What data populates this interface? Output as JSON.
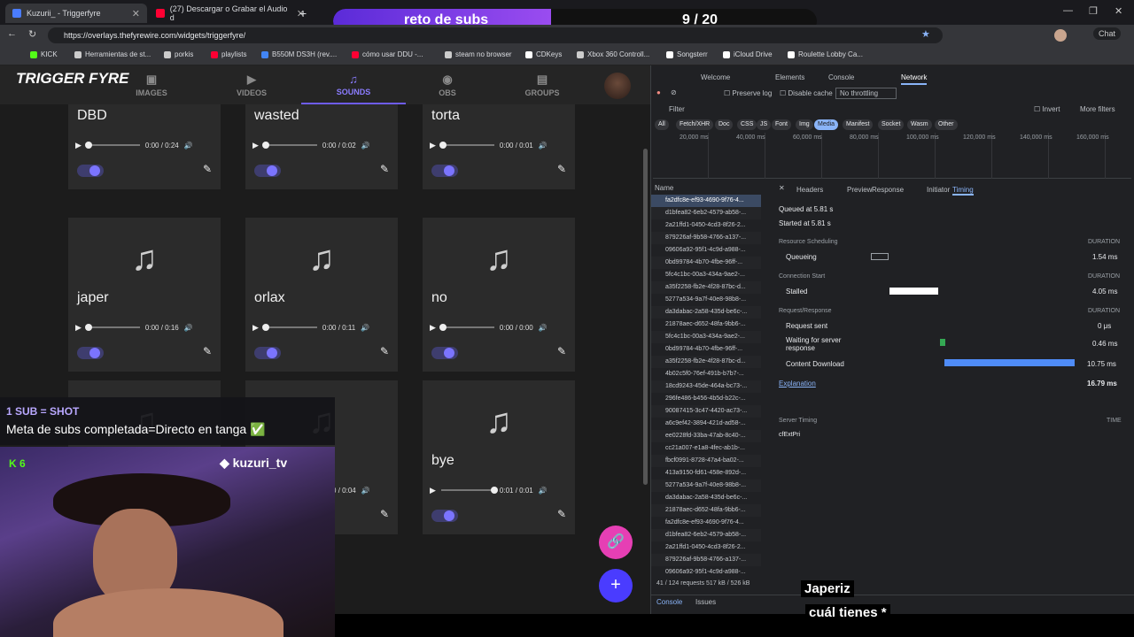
{
  "browser": {
    "tabs": [
      {
        "title": "Kuzurii_ - Triggerfyre",
        "active": true
      },
      {
        "title": "(27) Descargar o Grabar el Audio d",
        "active": false
      }
    ],
    "new_tab": "+",
    "url": "https://overlays.thefyrewire.com/widgets/triggerfyre/",
    "bookmarks": [
      "KICK",
      "Herramientas de st...",
      "porkis",
      "playlists",
      "B550M DS3H (rev....",
      "cómo usar DDU -...",
      "steam no browser",
      "CDKeys",
      "Xbox 360 Controll...",
      "Songsterr",
      "iCloud Drive",
      "Roulette Lobby Ca..."
    ],
    "chat_label": "Chat"
  },
  "subs_goal": {
    "label": "reto de subs",
    "count": "9 / 20",
    "progress": 0.45
  },
  "app": {
    "logo": "TRIGGER FYRE",
    "nav": [
      {
        "label": "IMAGES",
        "icon": "image-icon"
      },
      {
        "label": "VIDEOS",
        "icon": "video-icon"
      },
      {
        "label": "SOUNDS",
        "icon": "music-icon",
        "active": true
      },
      {
        "label": "OBS",
        "icon": "broadcast-icon"
      },
      {
        "label": "GROUPS",
        "icon": "folder-icon"
      }
    ],
    "sounds": [
      {
        "name": "DBD",
        "time": "0:00 / 0:24",
        "enabled": true
      },
      {
        "name": "wasted",
        "time": "0:00 / 0:02",
        "enabled": true
      },
      {
        "name": "torta",
        "time": "0:00 / 0:01",
        "enabled": true
      },
      {
        "name": "japer",
        "time": "0:00 / 0:16",
        "enabled": true
      },
      {
        "name": "orlax",
        "time": "0:00 / 0:11",
        "enabled": true
      },
      {
        "name": "no",
        "time": "0:00 / 0:00",
        "enabled": true
      },
      {
        "name": "",
        "time": "",
        "enabled": true
      },
      {
        "name": "",
        "time": "0:00 / 0:04",
        "enabled": true
      },
      {
        "name": "bye",
        "time": "0:01 / 0:01",
        "enabled": true
      }
    ]
  },
  "overlay": {
    "rule_title": "1 SUB = SHOT",
    "rule_text": "Meta de subs completada=Directo en tanga ✅",
    "kick_count": "6",
    "discord": "kuzuri_tv",
    "caption1": "Japeriz",
    "caption2": "cuál tienes *"
  },
  "devtools": {
    "tabs": [
      "Welcome",
      "Elements",
      "Console",
      "Network"
    ],
    "toolbar": {
      "preserve_log": "Preserve log",
      "disable_cache": "Disable cache",
      "throttling": "No throttling"
    },
    "filter_placeholder": "Filter",
    "invert": "Invert",
    "more_filters": "More filters",
    "type_filters": [
      "All",
      "Fetch/XHR",
      "Doc",
      "CSS",
      "JS",
      "Font",
      "Img",
      "Media",
      "Manifest",
      "Socket",
      "Wasm",
      "Other"
    ],
    "selected_filter": "Media",
    "timeline_ticks": [
      "20,000 ms",
      "40,000 ms",
      "60,000 ms",
      "80,000 ms",
      "100,000 ms",
      "120,000 ms",
      "140,000 ms",
      "160,000 ms"
    ],
    "name_header": "Name",
    "requests": [
      "fa2dfc8e-ef93-4690-9f76-4...",
      "d1bfea82-6eb2-4579-ab58-...",
      "2a21ffd1-0450-4cd3-8f26-2...",
      "879226af-9b58-4766-a137-...",
      "09606a92-95f1-4c9d-a988-...",
      "0bd99784-4b70-4fbe-96ff-...",
      "5fc4c1bc-00a3-434a-9ae2-...",
      "a35f2258-fb2e-4f28-87bc-d...",
      "5277a534-9a7f-40e8-98b8-...",
      "da3dabac-2a58-435d-be6c-...",
      "21878aec-d652-48fa-9bb6-...",
      "5fc4c1bc-00a3-434a-9ae2-...",
      "0bd99784-4b70-4fbe-96ff-...",
      "a35f2258-fb2e-4f28-87bc-d...",
      "4b02c5f0-76ef-491b-b7b7-...",
      "18cd9243-45de-464a-bc73-...",
      "296fe486-b456-4b5d-b22c-...",
      "90087415-3c47-4420-ac73-...",
      "a6c9ef42-3894-421d-ad58-...",
      "ee0228fd-33ba-47ab-8c40-...",
      "cc21a007-e1a8-4fec-ab1b-...",
      "fbcf0991-8728-47a4-ba02-...",
      "413a9150-fd61-458e-892d-...",
      "5277a534-9a7f-40e8-98b8-...",
      "da3dabac-2a58-435d-be6c-...",
      "21878aec-d652-48fa-9bb6-...",
      "fa2dfc8e-ef93-4690-9f76-4...",
      "d1bfea82-6eb2-4579-ab58-...",
      "2a21ffd1-0450-4cd3-8f26-2...",
      "879226af-9b58-4766-a137-...",
      "09606a92-95f1-4c9d-a988-..."
    ],
    "detail_tabs": [
      "Headers",
      "Preview",
      "Response",
      "Initiator",
      "Timing"
    ],
    "active_detail_tab": "Timing",
    "timing": {
      "queued": "Queued at 5.81 s",
      "started": "Started at 5.81 s",
      "resource_scheduling": "Resource Scheduling",
      "duration": "DURATION",
      "queueing": "Queueing",
      "queueing_val": "1.54 ms",
      "connection_start": "Connection Start",
      "stalled": "Stalled",
      "stalled_val": "4.05 ms",
      "request_response": "Request/Response",
      "request_sent": "Request sent",
      "request_sent_val": "0 μs",
      "waiting": "Waiting for server response",
      "waiting_val": "0.46 ms",
      "download": "Content Download",
      "download_val": "10.75 ms",
      "explanation": "Explanation",
      "total": "16.79 ms",
      "server_timing": "Server Timing",
      "time": "TIME",
      "cfext": "cfExtPri"
    },
    "status": "41 / 124 requests   517 kB / 526 kB",
    "drawer_tabs": [
      "Console",
      "Issues"
    ]
  }
}
